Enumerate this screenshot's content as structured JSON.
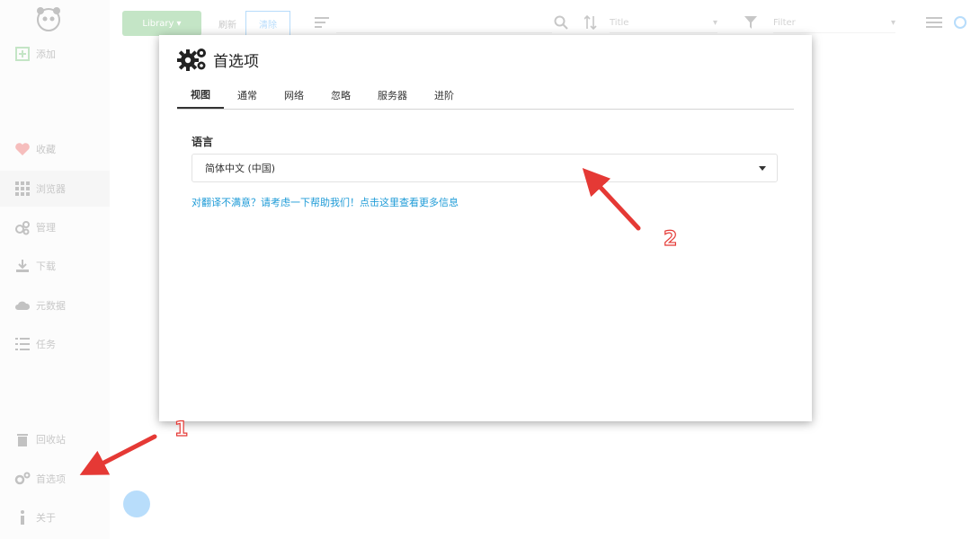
{
  "app": {
    "sidebar": {
      "items": [
        {
          "label": "添加",
          "icon": "plus-square-icon"
        },
        {
          "label": "收藏",
          "icon": "heart-icon"
        },
        {
          "label": "浏览器",
          "icon": "grid-icon"
        },
        {
          "label": "管理",
          "icon": "cogs-icon"
        },
        {
          "label": "下载",
          "icon": "download-icon"
        },
        {
          "label": "元数据",
          "icon": "cloud-icon"
        },
        {
          "label": "任务",
          "icon": "tasks-icon"
        },
        {
          "label": "回收站",
          "icon": "trash-icon"
        },
        {
          "label": "首选项",
          "icon": "gears-icon"
        },
        {
          "label": "关于",
          "icon": "info-icon"
        }
      ]
    },
    "toolbar": {
      "library_label": "Library",
      "btn2_label": "刷新",
      "btn3_label": "清除",
      "sort_value": "Title",
      "filter_value": "Filter"
    }
  },
  "dialog": {
    "title": "首选项",
    "tabs": [
      {
        "label": "视图",
        "active": true
      },
      {
        "label": "通常",
        "active": false
      },
      {
        "label": "网络",
        "active": false
      },
      {
        "label": "忽略",
        "active": false
      },
      {
        "label": "服务器",
        "active": false
      },
      {
        "label": "进阶",
        "active": false
      }
    ],
    "language_label": "语言",
    "language_value": "简体中文 (中国)",
    "help_link": "对翻译不满意？请考虑一下帮助我们！点击这里查看更多信息"
  },
  "annotations": {
    "marker1": "1",
    "marker2": "2",
    "arrow_color": "#e53935"
  },
  "colors": {
    "accent": "#2196f3",
    "library_green": "#4caf50",
    "link": "#1e9bd7"
  }
}
